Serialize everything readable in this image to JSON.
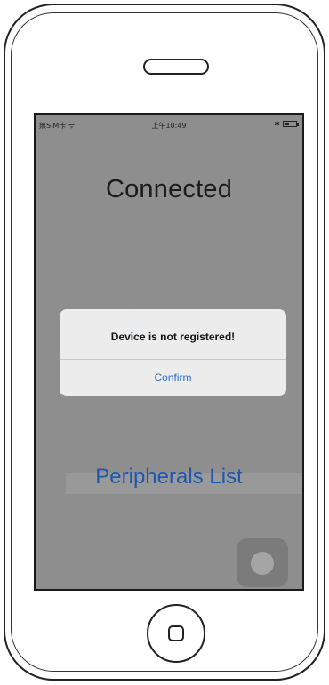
{
  "status_bar": {
    "carrier": "無SIM卡 ᯤ",
    "time": "上午10:49",
    "bluetooth": "✱"
  },
  "screen": {
    "title": "Connected",
    "peripherals_link": "Peripherals List"
  },
  "alert": {
    "message": "Device is not registered!",
    "confirm_label": "Confirm"
  },
  "colors": {
    "screen_dim": "#8e8e8e",
    "link_blue": "#1f57b0",
    "alert_button_blue": "#2a6fd0"
  }
}
